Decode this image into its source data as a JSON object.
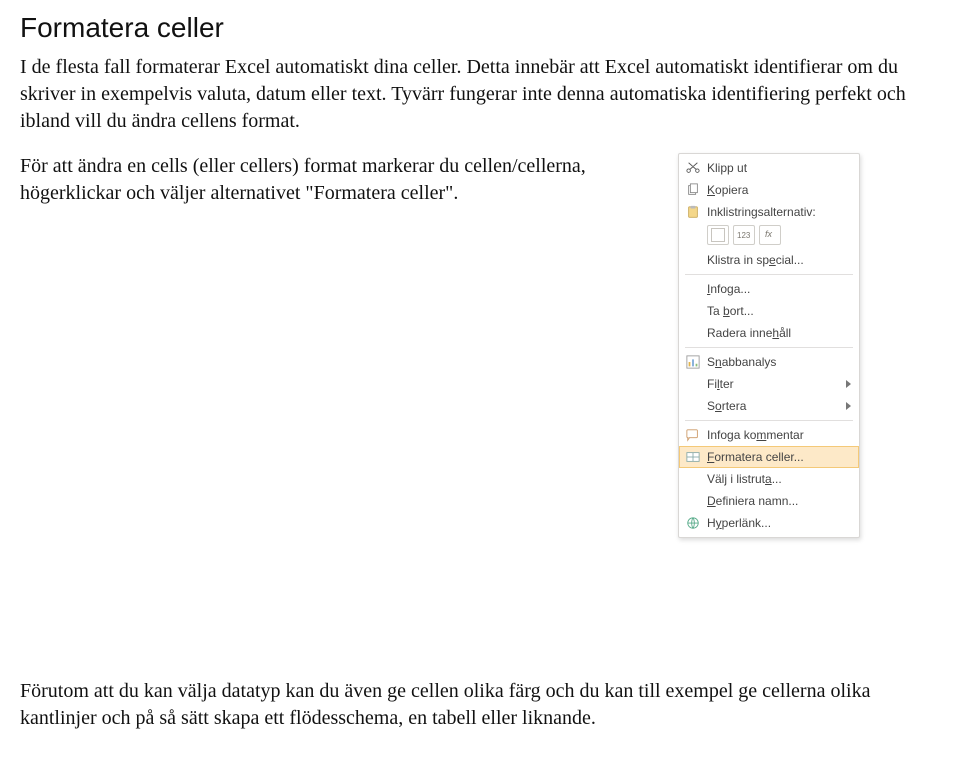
{
  "title": "Formatera celler",
  "p1": "I de flesta fall formaterar Excel automatiskt dina celler. Detta innebär att Excel automatiskt identifierar om du skriver in exempelvis valuta, datum eller text. Tyvärr fungerar inte denna automatiska identifiering perfekt och ibland vill du ändra cellens format.",
  "p2": "För att ändra en cells (eller cellers) format markerar du cellen/cellerna, högerklickar och väljer alternativet \"Formatera celler\".",
  "p3": "Förutom att du kan välja datatyp kan du även ge cellen olika färg och du kan till exempel ge cellerna olika kantlinjer och på så sätt skapa ett flödesschema, en tabell eller liknande.",
  "menu": {
    "cut": "Klipp ut",
    "copy": "Kopiera",
    "paste_opts": "Inklistringsalternativ:",
    "paste_special": "Klistra in special...",
    "insert": "Infoga...",
    "delete": "Ta bort...",
    "clear": "Radera innehåll",
    "quick": "Snabbanalys",
    "filter": "Filter",
    "sort": "Sortera",
    "comment": "Infoga kommentar",
    "format": "Formatera celler...",
    "picklist": "Välj i listruta...",
    "define": "Definiera namn...",
    "hyperlink": "Hyperlänk..."
  }
}
